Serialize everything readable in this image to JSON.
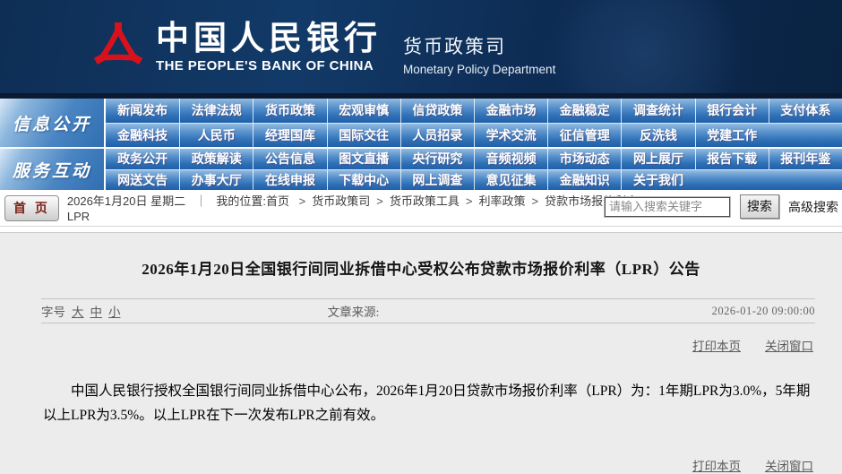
{
  "header": {
    "bank_name_cn": "中国人民银行",
    "bank_name_en": "THE PEOPLE'S BANK OF CHINA",
    "dept_cn": "货币政策司",
    "dept_en": "Monetary Policy Department"
  },
  "nav": {
    "sections": [
      {
        "label": "信息公开",
        "rows": [
          [
            "新闻发布",
            "法律法规",
            "货币政策",
            "宏观审慎",
            "信贷政策",
            "金融市场",
            "金融稳定",
            "调查统计",
            "银行会计",
            "支付体系"
          ],
          [
            "金融科技",
            "人民币",
            "经理国库",
            "国际交往",
            "人员招录",
            "学术交流",
            "征信管理",
            "反洗钱",
            "党建工作",
            ""
          ]
        ]
      },
      {
        "label": "服务互动",
        "rows": [
          [
            "政务公开",
            "政策解读",
            "公告信息",
            "图文直播",
            "央行研究",
            "音频视频",
            "市场动态",
            "网上展厅",
            "报告下载",
            "报刊年鉴"
          ],
          [
            "网送文告",
            "办事大厅",
            "在线申报",
            "下载中心",
            "网上调查",
            "意见征集",
            "金融知识",
            "关于我们",
            "",
            ""
          ]
        ]
      }
    ]
  },
  "breadcrumb": {
    "home_button": "首 页",
    "date": "2026年1月20日  星期二",
    "divider": "｜",
    "location_label": "我的位置:首页",
    "crumbs": [
      "货币政策司",
      "货币政策工具",
      "利率政策",
      "贷款市场报价利率"
    ],
    "line2": "LPR",
    "separator": ">"
  },
  "search": {
    "placeholder": "请输入搜索关键字",
    "button_label": "搜索",
    "advanced_label": "高级搜索"
  },
  "article": {
    "title": "2026年1月20日全国银行间同业拆借中心受权公布贷款市场报价利率（LPR）公告",
    "font_size_label": "字号",
    "sizes": [
      "大",
      "中",
      "小"
    ],
    "source_label": "文章来源:",
    "datetime": "2026-01-20 09:00:00",
    "print_label": "打印本页",
    "close_label": "关闭窗口",
    "body": "中国人民银行授权全国银行间同业拆借中心公布，2026年1月20日贷款市场报价利率（LPR）为：1年期LPR为3.0%，5年期以上LPR为3.5%。以上LPR在下一次发布LPR之前有效。"
  },
  "colors": {
    "header_navy": "#0d2b52",
    "nav_blue": "#2e6fb5",
    "logo_red": "#d8121c",
    "content_bg": "#ececec",
    "home_btn_text": "#7a1f15"
  }
}
